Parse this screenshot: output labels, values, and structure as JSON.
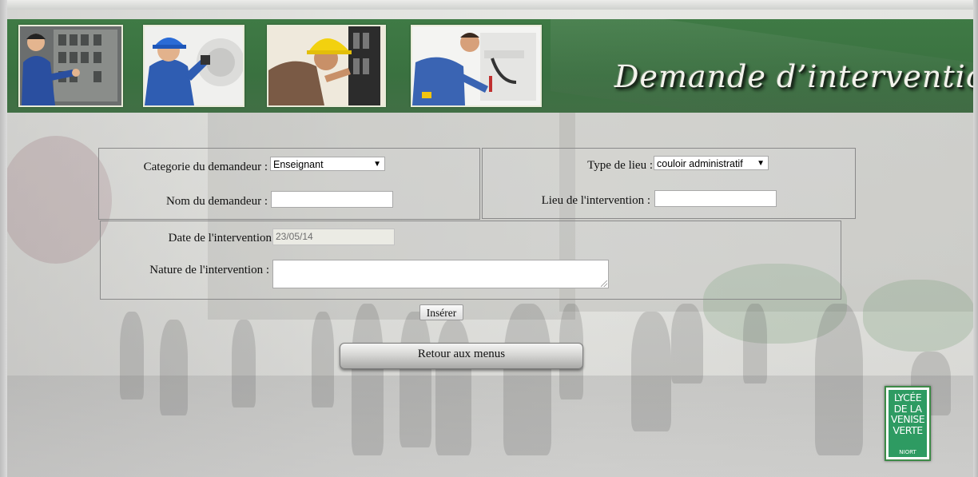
{
  "header": {
    "title": "Demande d’intervention",
    "photos": [
      "electrician-panel-photo",
      "technician-blue-helmet-photo",
      "electrician-yellow-helmet-photo",
      "plumber-photo"
    ]
  },
  "form": {
    "categorie_label": "Categorie du demandeur :",
    "categorie_value": "Enseignant",
    "nom_label": "Nom du demandeur :",
    "nom_value": "",
    "type_lieu_label": "Type de lieu :",
    "type_lieu_value": "couloir administratif",
    "lieu_label": "Lieu de l'intervention :",
    "lieu_value": "",
    "date_label": "Date de l'intervention",
    "date_value": "23/05/14",
    "nature_label": "Nature de l'intervention :",
    "nature_value": ""
  },
  "buttons": {
    "insert_label": "Insérer",
    "back_label": "Retour aux menus"
  },
  "logo": {
    "line1": "LYCÉE",
    "line2": "DE LA",
    "line3": "VENISE",
    "line4": "VERTE",
    "city": "NIORT"
  },
  "colors": {
    "header_green": "#3f7a45",
    "logo_green": "#2e9b62"
  }
}
